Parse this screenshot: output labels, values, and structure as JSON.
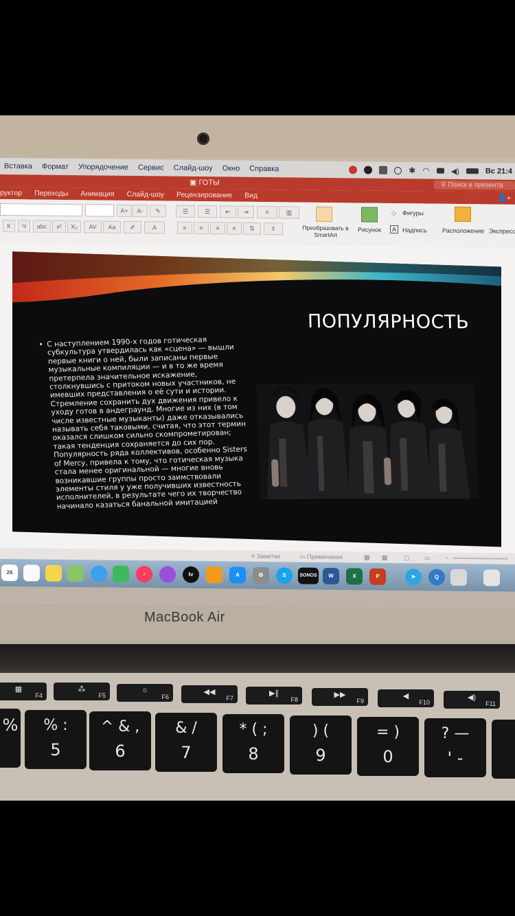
{
  "menubar": {
    "items": [
      "Вставка",
      "Формат",
      "Упорядочение",
      "Сервис",
      "Слайд-шоу",
      "Окно",
      "Справка"
    ],
    "clock": "Вс 21:4"
  },
  "window": {
    "title": "ГОТЫ",
    "search_placeholder": "Поиск в презента"
  },
  "ribbon": {
    "tabs": [
      "руктор",
      "Переходы",
      "Анимация",
      "Слайд-шоу",
      "Рецензирование",
      "Вид"
    ],
    "smartart": "Преобразовать в SmartArt",
    "picture": "Рисунок",
    "shapes": "Фигуры",
    "textbox": "Надпись",
    "arrange": "Расположение",
    "express": "Экспресс"
  },
  "slide": {
    "title": "ПОПУЛЯРНОСТЬ",
    "body": "С наступлением 1990-х годов готическая субкультура утвердилась как «сцена» — вышли первые книги о ней, были записаны первые музыкальные компиляции — и в то же время претерпела значительное искажение, столкнувшись с притоком новых участников, не имевших представления о её сути и истории. Стремление сохранить дух движения привело к уходу готов в андеграунд. Многие из них (в том числе известные музыканты) даже отказывались называть себя таковыми, считая, что этот термин оказался слишком сильно скомпрометирован; такая тенденция сохраняется до сих пор. Популярность ряда коллективов, особенно Sisters of Mercy, привела к тому, что готическая музыка стала менее оригинальной — многие вновь возникавшие группы просто заимствовали элементы стиля у уже получивших известность исполнителей, в результате чего их творчество начинало казаться банальной имитацией"
  },
  "statusbar": {
    "notes": "Заметки",
    "comments": "Примечания"
  },
  "dock": {
    "calendar_day": "26",
    "sonos": "SONOS"
  },
  "laptop": {
    "brand": "MacBook Air"
  },
  "fkeys": [
    "F4",
    "F5",
    "F6",
    "F7",
    "F8",
    "F9",
    "F10",
    "F11"
  ],
  "keys": [
    {
      "top": "",
      "bottom": "%"
    },
    {
      "top": "% :",
      "bottom": "5"
    },
    {
      "top": "^ & ,",
      "bottom": "6"
    },
    {
      "top": "& /",
      "bottom": "7"
    },
    {
      "top": "* ( ;",
      "bottom": "8"
    },
    {
      "top": ") (",
      "bottom": "9"
    },
    {
      "top": "= )",
      "bottom": "0"
    },
    {
      "top": "? —",
      "bottom": "' -"
    }
  ]
}
